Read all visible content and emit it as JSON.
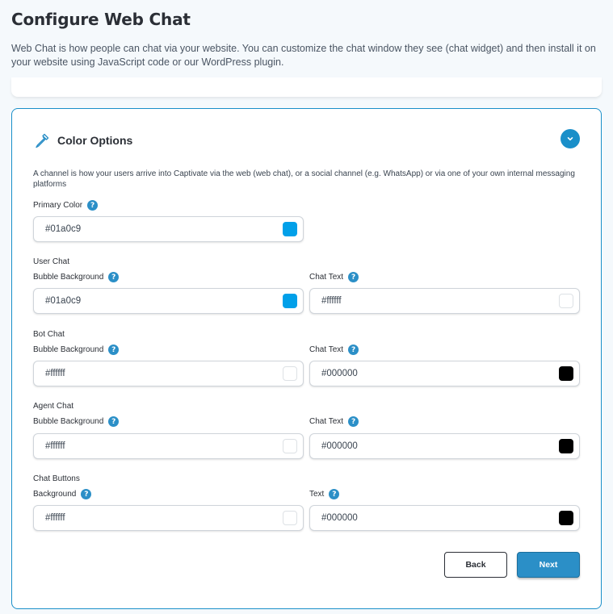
{
  "page": {
    "title": "Configure Web Chat",
    "description": "Web Chat is how people can chat via your website. You can customize the chat window they see (chat widget) and then install it on your website using JavaScript code or our WordPress plugin."
  },
  "card": {
    "title": "Color Options",
    "icon": "eyedropper-icon",
    "collapse_icon": "chevron-down-icon",
    "description": "A channel is how your users arrive into Captivate via the web (web chat), or a social channel (e.g. WhatsApp) or via one of your own internal messaging platforms"
  },
  "help_glyph": "?",
  "primary": {
    "label": "Primary Color",
    "value": "#01a0c9",
    "swatch": "#01a0e9"
  },
  "user_chat": {
    "section": "User Chat",
    "bubble_label": "Bubble Background",
    "bubble_value": "#01a0c9",
    "bubble_swatch": "#01a0e9",
    "text_label": "Chat Text",
    "text_value": "#ffffff",
    "text_swatch": "#ffffff"
  },
  "bot_chat": {
    "section": "Bot Chat",
    "bubble_label": "Bubble Background",
    "bubble_value": "#ffffff",
    "bubble_swatch": "#ffffff",
    "text_label": "Chat Text",
    "text_value": "#000000",
    "text_swatch": "#000000"
  },
  "agent_chat": {
    "section": "Agent Chat",
    "bubble_label": "Bubble Background",
    "bubble_value": "#ffffff",
    "bubble_swatch": "#ffffff",
    "text_label": "Chat Text",
    "text_value": "#000000",
    "text_swatch": "#000000"
  },
  "chat_buttons": {
    "section": "Chat Buttons",
    "bg_label": "Background",
    "bg_value": "#ffffff",
    "bg_swatch": "#ffffff",
    "text_label": "Text",
    "text_value": "#000000",
    "text_swatch": "#000000"
  },
  "actions": {
    "back_label": "Back",
    "next_label": "Next"
  },
  "colors": {
    "accent": "#2b8fc7",
    "card_border": "#1a8fc9"
  }
}
